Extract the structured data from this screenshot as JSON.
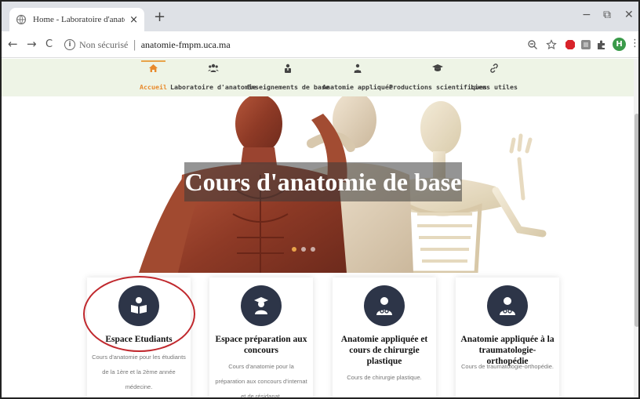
{
  "browser": {
    "tab_title": "Home - Laboratoire d'anatomie",
    "tab_close": "×",
    "new_tab": "+",
    "window_controls": {
      "minimize": "−",
      "restore": "⧉",
      "close": "✕"
    },
    "nav": {
      "back": "←",
      "forward": "→",
      "reload": "C"
    },
    "security_label": "Non sécurisé",
    "separator": "|",
    "url": "anatomie-fmpm.uca.ma",
    "profile_initial": "H",
    "menu": "⋮"
  },
  "site_nav": {
    "items": [
      {
        "label": "Accueil",
        "icon": "home-icon",
        "active": true
      },
      {
        "label": "Laboratoire d'anatomie",
        "icon": "users-icon"
      },
      {
        "label": "Enseignements de base",
        "icon": "teacher-icon"
      },
      {
        "label": "Anatomie appliquée",
        "icon": "user-tie-icon"
      },
      {
        "label": "Productions scientifiques",
        "icon": "graduation-cap-icon"
      },
      {
        "label": "Liens utiles",
        "icon": "link-icon"
      }
    ]
  },
  "hero": {
    "title": "Cours d'anatomie de base"
  },
  "cards": [
    {
      "title": "Espace Etudiants",
      "description": [
        "Cours d'anatomie pour les étudiants",
        "de la 1ère et la 2ème année",
        "médecine."
      ],
      "icon": "book-reader-icon"
    },
    {
      "title": "Espace préparation aux concours",
      "description": [
        "Cours d'anatomie pour la",
        "préparation aux concours d'internat",
        "et de résidanat."
      ],
      "icon": "graduate-icon"
    },
    {
      "title": "Anatomie appliquée et cours de chirurgie plastique",
      "description": [
        "Cours de chirurgie plastique."
      ],
      "icon": "doctor-icon"
    },
    {
      "title": "Anatomie appliquée à la traumatologie-orthopédie",
      "description": [
        "Cours de traumatologie-orthopédie."
      ],
      "icon": "doctor-icon"
    }
  ],
  "colors": {
    "accent": "#e88a2c",
    "nav_bg": "#eef4e6",
    "card_icon_bg": "#2d3548",
    "highlight_circle": "#c0282d"
  }
}
